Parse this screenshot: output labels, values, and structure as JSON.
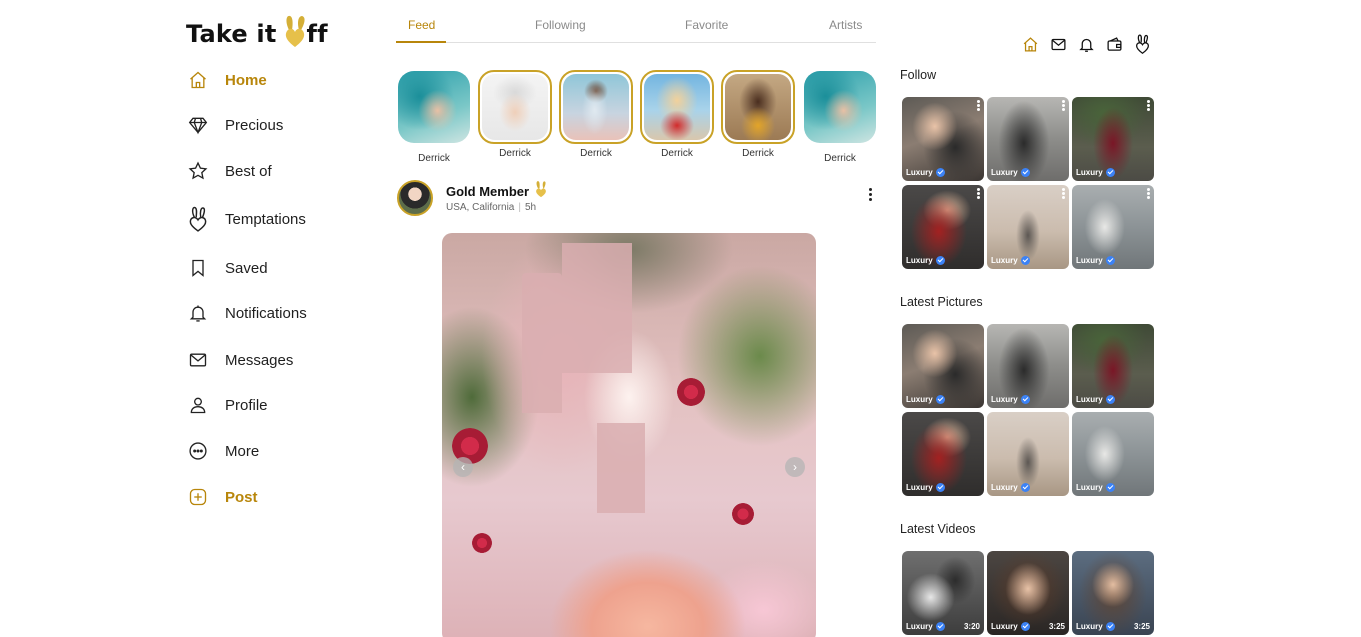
{
  "brand": {
    "name": "Take it ",
    "name_tail": "ff",
    "accent": "#b8860b",
    "gold": "#c9a227"
  },
  "nav": [
    {
      "label": "Home",
      "icon": "home-icon",
      "active": true
    },
    {
      "label": "Precious",
      "icon": "diamond-icon"
    },
    {
      "label": "Best of",
      "icon": "star-icon"
    },
    {
      "label": "Temptations",
      "icon": "bunny-heart-icon"
    },
    {
      "label": "Saved",
      "icon": "bookmark-icon"
    },
    {
      "label": "Notifications",
      "icon": "bell-icon"
    },
    {
      "label": "Messages",
      "icon": "mail-icon"
    },
    {
      "label": "Profile",
      "icon": "user-icon"
    },
    {
      "label": "More",
      "icon": "more-circle-icon"
    },
    {
      "label": "Post",
      "icon": "plus-square-icon"
    }
  ],
  "tabs": [
    {
      "label": "Feed",
      "active": true
    },
    {
      "label": "Following"
    },
    {
      "label": "Favorite"
    },
    {
      "label": "Artists"
    }
  ],
  "stories": [
    {
      "name": "Derrick",
      "ringed": false
    },
    {
      "name": "Derrick",
      "ringed": true
    },
    {
      "name": "Derrick",
      "ringed": true
    },
    {
      "name": "Derrick",
      "ringed": true
    },
    {
      "name": "Derrick",
      "ringed": true
    },
    {
      "name": "Derrick",
      "ringed": false
    }
  ],
  "post": {
    "author": "Gold Member",
    "location": "USA, California",
    "separator": "|",
    "time": "5h",
    "prev_icon": "‹",
    "next_icon": "›"
  },
  "header_icons": [
    "home-icon",
    "mail-icon",
    "bell-icon",
    "wallet-icon",
    "bunny-heart-icon"
  ],
  "sections": {
    "follow": {
      "title": "Follow",
      "items": [
        {
          "label": "Luxury"
        },
        {
          "label": "Luxury"
        },
        {
          "label": "Luxury"
        },
        {
          "label": "Luxury"
        },
        {
          "label": "Luxury"
        },
        {
          "label": "Luxury"
        }
      ]
    },
    "latest_pictures": {
      "title": "Latest Pictures",
      "items": [
        {
          "label": "Luxury"
        },
        {
          "label": "Luxury"
        },
        {
          "label": "Luxury"
        },
        {
          "label": "Luxury"
        },
        {
          "label": "Luxury"
        },
        {
          "label": "Luxury"
        }
      ]
    },
    "latest_videos": {
      "title": "Latest Videos",
      "items": [
        {
          "label": "Luxury",
          "duration": "3:20"
        },
        {
          "label": "Luxury",
          "duration": "3:25"
        },
        {
          "label": "Luxury",
          "duration": "3:25"
        }
      ]
    }
  }
}
